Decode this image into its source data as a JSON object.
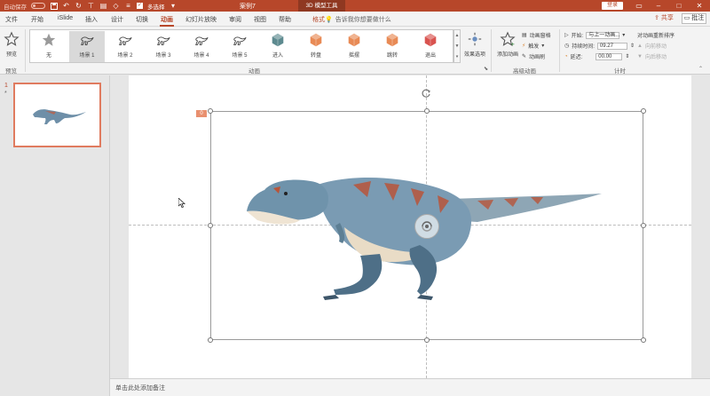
{
  "titlebar": {
    "autosave_label": "自动保存",
    "autosave_state": "关",
    "multiselect_label": "多选择",
    "doc_title": "案例7",
    "tool_tab": "3D 模型工具",
    "login": "登录",
    "minimize_icon": "minimize-icon",
    "maximize_icon": "maximize-icon",
    "close_icon": "close-icon"
  },
  "tabs": {
    "file": "文件",
    "home": "开始",
    "islide": "iSlide",
    "insert": "插入",
    "design": "设计",
    "transitions": "切换",
    "animations": "动画",
    "slideshow": "幻灯片放映",
    "review": "审阅",
    "view": "视图",
    "help": "帮助",
    "format": "格式",
    "search": "告诉我你想要做什么",
    "share": "共享",
    "comment": "批注"
  },
  "ribbon": {
    "preview": {
      "label": "预览",
      "group": "预览"
    },
    "animation_gallery": {
      "items": [
        {
          "label": "无",
          "icon": "star-icon"
        },
        {
          "label": "场景 1",
          "icon": "dinosaur-icon"
        },
        {
          "label": "场景 2",
          "icon": "dinosaur-icon"
        },
        {
          "label": "场景 3",
          "icon": "dinosaur-icon"
        },
        {
          "label": "场景 4",
          "icon": "dinosaur-icon"
        },
        {
          "label": "场景 5",
          "icon": "dinosaur-icon"
        },
        {
          "label": "进入",
          "icon": "cube-enter-icon"
        },
        {
          "label": "转盘",
          "icon": "cube-turntable-icon"
        },
        {
          "label": "摇摆",
          "icon": "cube-swing-icon"
        },
        {
          "label": "跳转",
          "icon": "cube-jump-icon"
        },
        {
          "label": "退出",
          "icon": "cube-exit-icon"
        }
      ],
      "selected_index": 1,
      "group": "动画"
    },
    "effect_options": "效果选项",
    "advanced": {
      "add_animation": "添加动画",
      "animation_pane": "动画窗格",
      "trigger": "触发",
      "animation_painter": "动画刷",
      "group": "高级动画"
    },
    "timing": {
      "start_label": "开始:",
      "start_value": "与上一动画...",
      "duration_label": "持续时间:",
      "duration_value": "09.27",
      "delay_label": "延迟:",
      "delay_value": "00.00",
      "reorder_title": "对动画重新排序",
      "move_earlier": "向前移动",
      "move_later": "向后移动",
      "group": "计时"
    },
    "colors": {
      "accent": "#b7472a",
      "selected_tile": "#d9d9d9"
    }
  },
  "slides": {
    "number": "1",
    "star": "*"
  },
  "canvas": {
    "anim_badge": "0"
  },
  "notes": {
    "placeholder": "单击此处添加备注"
  }
}
